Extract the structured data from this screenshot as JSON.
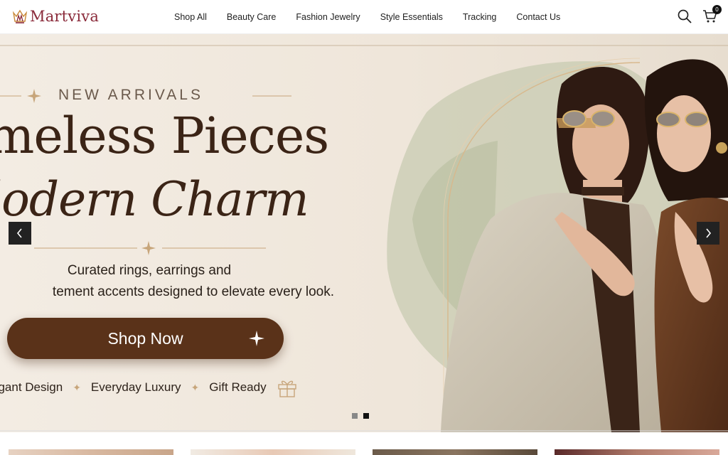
{
  "header": {
    "brand": "Martviva",
    "nav": [
      "Shop All",
      "Beauty Care",
      "Fashion Jewelry",
      "Style Essentials",
      "Tracking",
      "Contact Us"
    ],
    "cart_count": "0",
    "icons": {
      "search": "search-icon",
      "cart": "cart-icon"
    }
  },
  "hero": {
    "eyebrow": "NEW ARRIVALS",
    "headline_line1": "meless Pieces",
    "headline_line2": "lodern Charm",
    "subtitle_line1": "Curated rings, earrings and",
    "subtitle_line2": "tement accents designed to elevate every look.",
    "cta_label": "Shop Now",
    "features": [
      "egant Design",
      "Everyday Luxury",
      "Gift Ready"
    ],
    "slide_count": 2,
    "active_slide": 2
  },
  "colors": {
    "brand": "#8a2a3a",
    "hero_background": "#efe6da",
    "headline": "#3b2416",
    "cta_background": "#5a3219",
    "accent_gold": "#c7a57a"
  }
}
